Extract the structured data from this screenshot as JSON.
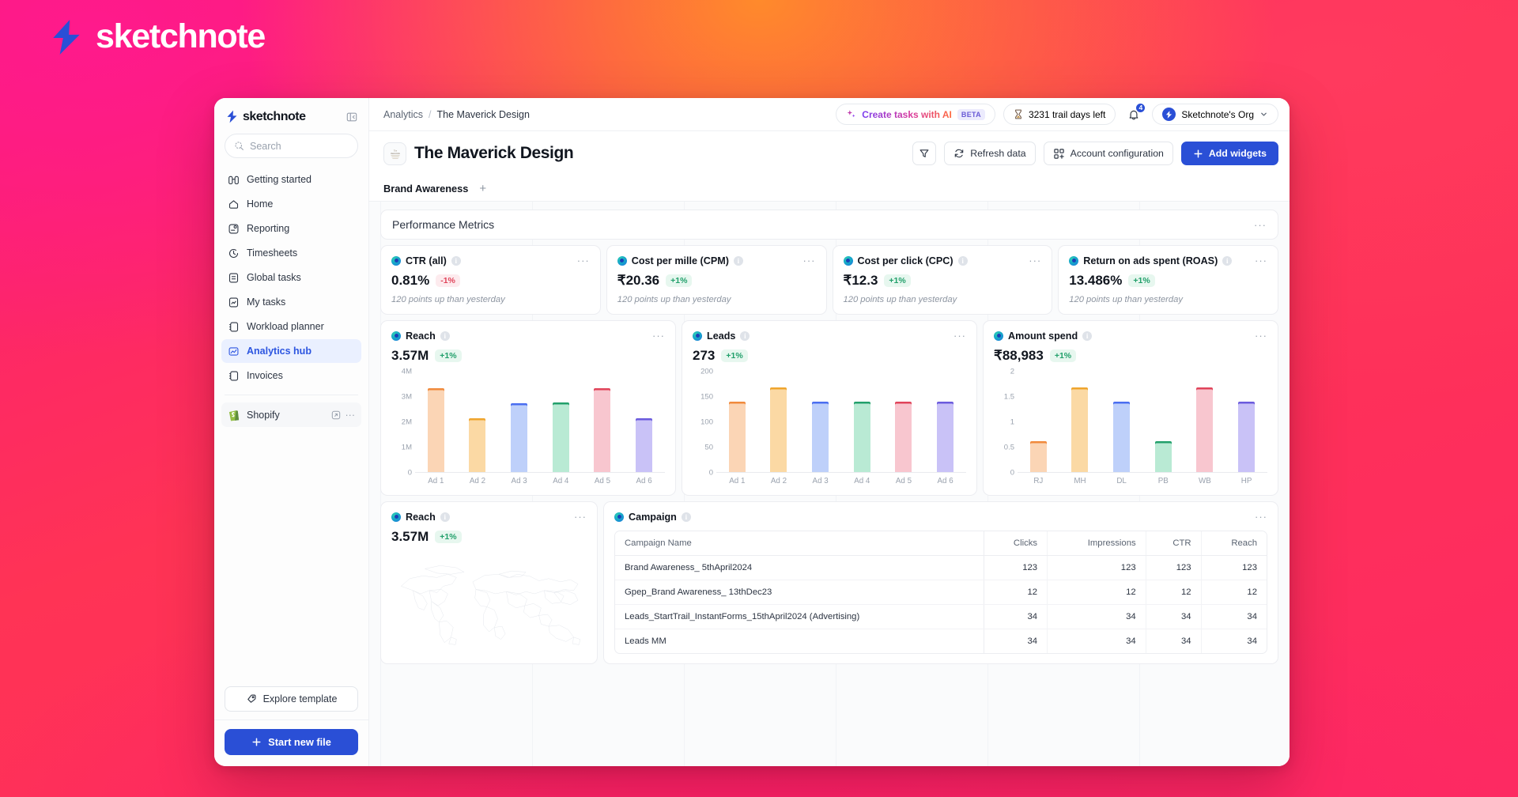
{
  "brand": {
    "name": "sketchnote"
  },
  "sidebar": {
    "logo": "sketchnote",
    "search_placeholder": "Search",
    "items": [
      {
        "label": "Getting started",
        "icon": "binoculars-icon",
        "active": false
      },
      {
        "label": "Home",
        "icon": "home-icon",
        "active": false
      },
      {
        "label": "Reporting",
        "icon": "report-icon",
        "active": false
      },
      {
        "label": "Timesheets",
        "icon": "clock-icon",
        "active": false
      },
      {
        "label": "Global tasks",
        "icon": "list-icon",
        "active": false
      },
      {
        "label": "My tasks",
        "icon": "task-icon",
        "active": false
      },
      {
        "label": "Workload planner",
        "icon": "planner-icon",
        "active": false
      },
      {
        "label": "Analytics hub",
        "icon": "analytics-icon",
        "active": true
      },
      {
        "label": "Invoices",
        "icon": "invoice-icon",
        "active": false
      }
    ],
    "app": {
      "label": "Shopify",
      "icon": "shopify-icon"
    },
    "explore_label": "Explore template",
    "start_label": "Start new file"
  },
  "topbar": {
    "breadcrumb_root": "Analytics",
    "breadcrumb_sep": "/",
    "breadcrumb_current": "The Maverick Design",
    "ai_label": "Create tasks with AI",
    "ai_badge": "BETA",
    "trial_label": "3231 trail days left",
    "notification_count": "4",
    "org_label": "Sketchnote's Org"
  },
  "titlebar": {
    "page_title": "The Maverick Design",
    "filter_label": "filter-icon",
    "refresh_label": "Refresh data",
    "account_config_label": "Account configuration",
    "add_widgets_label": "Add widgets"
  },
  "tabs": {
    "items": [
      "Brand Awareness"
    ],
    "add": "+"
  },
  "section": {
    "title": "Performance Metrics",
    "menu": "···"
  },
  "kpis": [
    {
      "name": "CTR (all)",
      "value": "0.81%",
      "delta": "-1%",
      "direction": "down",
      "sub": "120 points up than yesterday"
    },
    {
      "name": "Cost per mille (CPM)",
      "value": "₹20.36",
      "delta": "+1%",
      "direction": "up",
      "sub": "120 points up than yesterday"
    },
    {
      "name": "Cost per click (CPC)",
      "value": "₹12.3",
      "delta": "+1%",
      "direction": "up",
      "sub": "120 points up than yesterday"
    },
    {
      "name": "Return on ads spent (ROAS)",
      "value": "13.486%",
      "delta": "+1%",
      "direction": "up",
      "sub": "120 points up than yesterday"
    }
  ],
  "chart_data": [
    {
      "type": "bar",
      "title": "Reach",
      "headline_value": "3.57M",
      "delta": "+1%",
      "categories": [
        "Ad 1",
        "Ad 2",
        "Ad 3",
        "Ad 4",
        "Ad 5",
        "Ad 6"
      ],
      "values": [
        3.35,
        2.15,
        2.75,
        2.78,
        3.35,
        2.15
      ],
      "tick_labels": [
        "4M",
        "3M",
        "2M",
        "1M",
        "0"
      ],
      "ylim": [
        0,
        4
      ],
      "xlabel": "",
      "ylabel": "",
      "grid": false,
      "legend": "none",
      "bar_colors": [
        "#fbd5b5",
        "#fbd9a4",
        "#bed0fa",
        "#b9ead4",
        "#f8c6cf",
        "#c9c2f7"
      ],
      "cap_colors": [
        "#f08a3d",
        "#efa52e",
        "#4a6ef0",
        "#22a06b",
        "#e0445a",
        "#6b5bdd"
      ]
    },
    {
      "type": "bar",
      "title": "Leads",
      "headline_value": "273",
      "delta": "+1%",
      "categories": [
        "Ad 1",
        "Ad 2",
        "Ad 3",
        "Ad 4",
        "Ad 5",
        "Ad 6"
      ],
      "values": [
        140,
        168,
        140,
        140,
        140,
        140
      ],
      "tick_labels": [
        "200",
        "150",
        "100",
        "50",
        "0"
      ],
      "ylim": [
        0,
        200
      ],
      "xlabel": "",
      "ylabel": "",
      "grid": false,
      "legend": "none",
      "bar_colors": [
        "#fbd5b5",
        "#fbd9a4",
        "#bed0fa",
        "#b9ead4",
        "#f8c6cf",
        "#c9c2f7"
      ],
      "cap_colors": [
        "#f08a3d",
        "#efa52e",
        "#4a6ef0",
        "#22a06b",
        "#e0445a",
        "#6b5bdd"
      ]
    },
    {
      "type": "bar",
      "title": "Amount spend",
      "headline_value": "₹88,983",
      "delta": "+1%",
      "categories": [
        "RJ",
        "MH",
        "DL",
        "PB",
        "WB",
        "HP"
      ],
      "values": [
        0.62,
        1.68,
        1.4,
        0.62,
        1.68,
        1.4
      ],
      "tick_labels": [
        "2",
        "1.5",
        "1",
        "0.5",
        "0"
      ],
      "ylim": [
        0,
        2
      ],
      "xlabel": "",
      "ylabel": "",
      "grid": false,
      "legend": "none",
      "bar_colors": [
        "#fbd5b5",
        "#fbd9a4",
        "#bed0fa",
        "#b9ead4",
        "#f8c6cf",
        "#c9c2f7"
      ],
      "cap_colors": [
        "#f08a3d",
        "#efa52e",
        "#4a6ef0",
        "#22a06b",
        "#e0445a",
        "#6b5bdd"
      ]
    }
  ],
  "reach_map": {
    "title": "Reach",
    "headline_value": "3.57M",
    "delta": "+1%"
  },
  "campaign": {
    "title": "Campaign",
    "columns": [
      "Campaign Name",
      "Clicks",
      "Impressions",
      "CTR",
      "Reach"
    ],
    "rows": [
      {
        "name": "Brand Awareness_ 5thApril2024",
        "clicks": "123",
        "impressions": "123",
        "ctr": "123",
        "reach": "123"
      },
      {
        "name": "Gpep_Brand Awareness_ 13thDec23",
        "clicks": "12",
        "impressions": "12",
        "ctr": "12",
        "reach": "12"
      },
      {
        "name": "Leads_StartTrail_InstantForms_15thApril2024 (Advertising)",
        "clicks": "34",
        "impressions": "34",
        "ctr": "34",
        "reach": "34"
      },
      {
        "name": "Leads MM",
        "clicks": "34",
        "impressions": "34",
        "ctr": "34",
        "reach": "34"
      }
    ]
  },
  "colors": {
    "accent": "#2a4fd6",
    "up": "#22a06b",
    "down": "#e0445a",
    "active_nav_bg": "#eaf0ff"
  }
}
